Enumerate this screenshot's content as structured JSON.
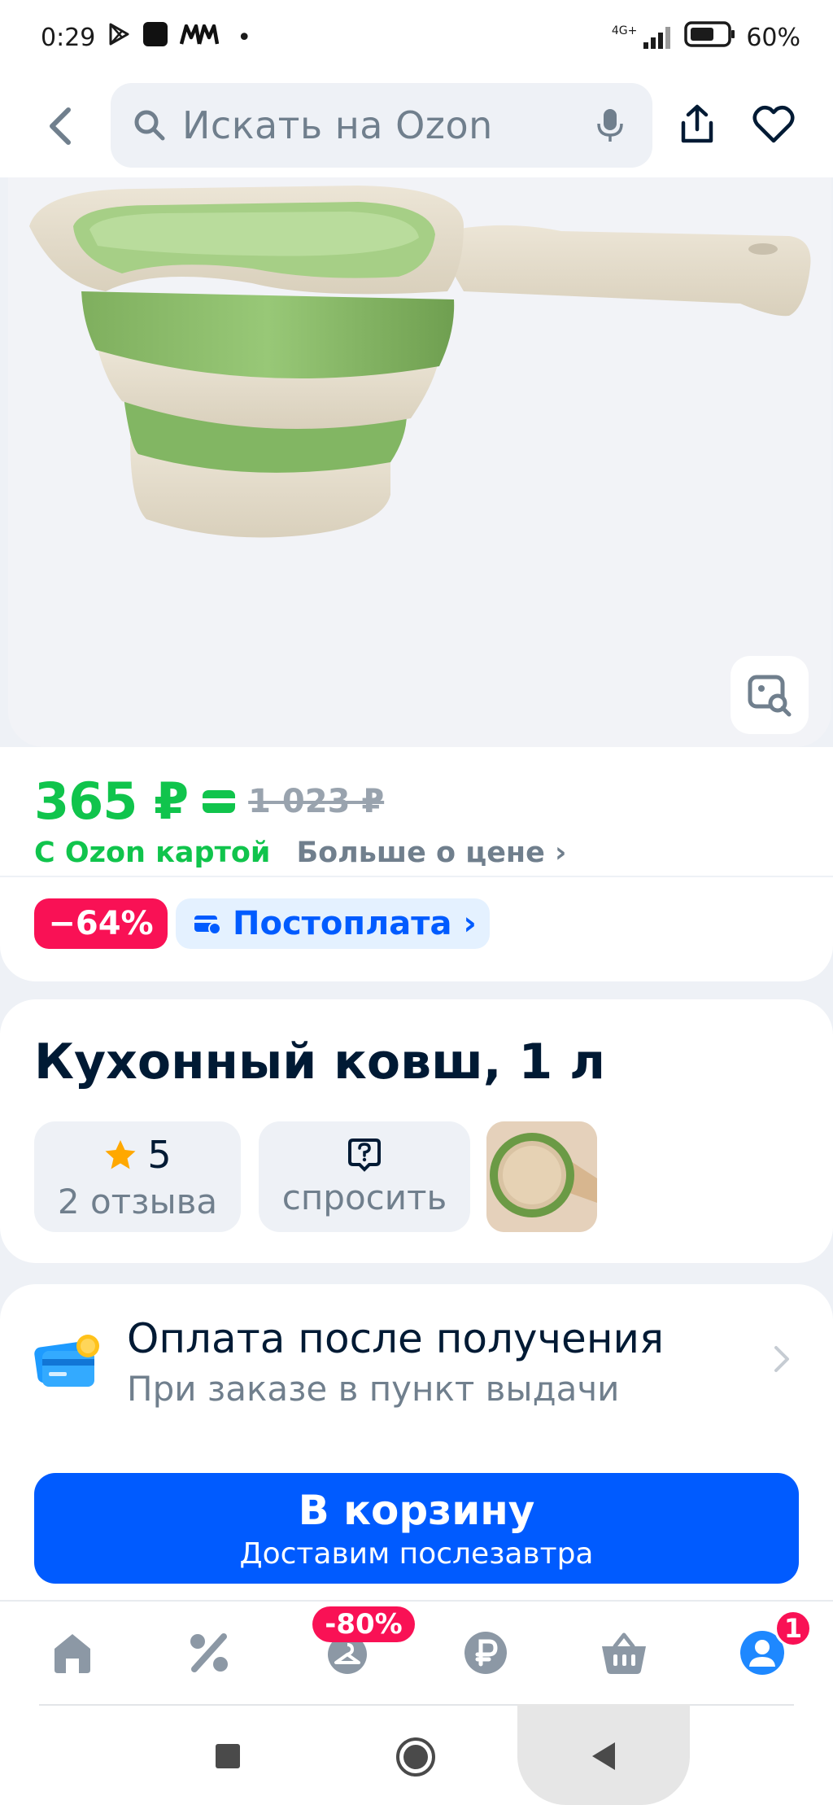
{
  "status_bar": {
    "time": "0:29",
    "network": "4G+",
    "battery": "60%"
  },
  "header": {
    "search_placeholder": "Искать на Ozon"
  },
  "price": {
    "current": "365 ₽",
    "old": "1 023 ₽",
    "ozon_card_label": "С Ozon картой",
    "more_label": "Больше о цене ›",
    "discount": "−64%",
    "postpay_label": "Постоплата ›"
  },
  "product": {
    "title": "Кухонный ковш, 1 л",
    "rating_value": "5",
    "reviews_label": "2 отзыва",
    "ask_label": "спросить"
  },
  "payment": {
    "title": "Оплата после получения",
    "subtitle": "При заказе в пункт выдачи"
  },
  "cart_button": {
    "title": "В корзину",
    "subtitle": "Доставим послезавтра"
  },
  "tabbar": {
    "promo_badge": "-80%",
    "profile_badge": "1"
  },
  "colors": {
    "brand_blue": "#005bff",
    "price_green": "#10c44c",
    "badge_red": "#f91155"
  }
}
